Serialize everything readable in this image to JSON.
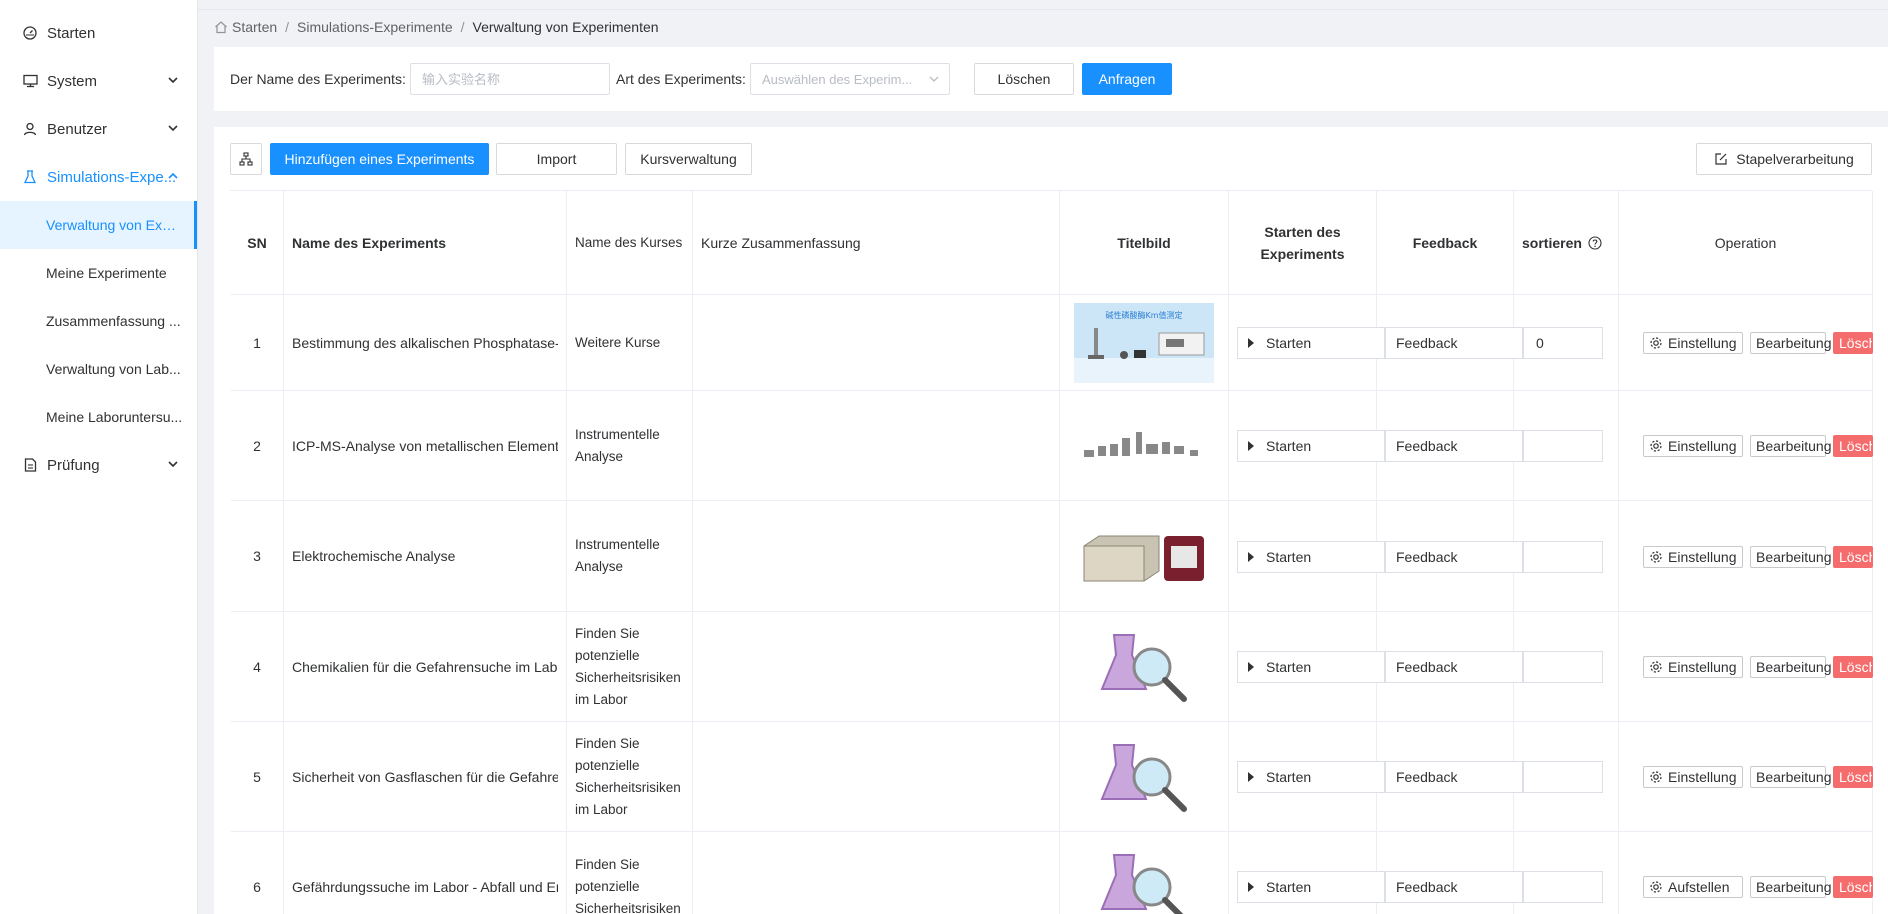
{
  "sidebar": {
    "items": [
      {
        "label": "Starten",
        "icon": "dashboard-icon"
      },
      {
        "label": "System",
        "icon": "monitor-icon"
      },
      {
        "label": "Benutzer",
        "icon": "user-icon"
      },
      {
        "label": "Simulations-Expe...",
        "icon": "flask-icon"
      },
      {
        "label": "Prüfung",
        "icon": "document-icon"
      }
    ],
    "subitems": [
      "Verwaltung von Exp...",
      "Meine Experimente",
      "Zusammenfassung ...",
      "Verwaltung von Lab...",
      "Meine Laboruntersu..."
    ]
  },
  "breadcrumb": {
    "home": "Starten",
    "sep": "/",
    "level2": "Simulations-Experimente",
    "current": "Verwaltung von Experimenten"
  },
  "search": {
    "name_label": "Der Name des Experiments:",
    "name_placeholder": "输入实验名称",
    "type_label": "Art des Experiments:",
    "type_placeholder": "Auswählen des Experim...",
    "reset_label": "Löschen",
    "query_label": "Anfragen"
  },
  "toolbar": {
    "add_label": "Hinzufügen eines Experiments",
    "import_label": "Import",
    "course_label": "Kursverwaltung",
    "batch_label": "Stapelverarbeitung"
  },
  "table": {
    "headers": {
      "sn": "SN",
      "name": "Name des Experiments",
      "course": "Name des Kurses",
      "summary": "Kurze Zusammenfassung",
      "cover": "Titelbild",
      "start": "Starten des Experiments",
      "feedback": "Feedback",
      "sort": "sortieren",
      "operation": "Operation"
    },
    "rows": [
      {
        "sn": "1",
        "name": "Bestimmung des alkalischen Phosphatase-K",
        "course": "Weitere Kurse",
        "start": "Starten",
        "feedback": "Feedback",
        "sort": "0",
        "setting": "Einstellung",
        "edit": "Bearbeitung",
        "delete": "Löschen",
        "cover_text": "碱性磷酸酶Km值测定"
      },
      {
        "sn": "2",
        "name": "ICP-MS-Analyse von metallischen Elemente",
        "course": "Instrumentelle Analyse",
        "start": "Starten",
        "feedback": "Feedback",
        "sort": "",
        "setting": "Einstellung",
        "edit": "Bearbeitung",
        "delete": "Löschen"
      },
      {
        "sn": "3",
        "name": "Elektrochemische Analyse",
        "course": "Instrumentelle Analyse",
        "start": "Starten",
        "feedback": "Feedback",
        "sort": "",
        "setting": "Einstellung",
        "edit": "Bearbeitung",
        "delete": "Löschen"
      },
      {
        "sn": "4",
        "name": "Chemikalien für die Gefahrensuche im Labo",
        "course": "Finden Sie potenzielle Sicherheitsrisiken im Labor",
        "start": "Starten",
        "feedback": "Feedback",
        "sort": "",
        "setting": "Einstellung",
        "edit": "Bearbeitung",
        "delete": "Löschen"
      },
      {
        "sn": "5",
        "name": "Sicherheit von Gasflaschen für die Gefahrer",
        "course": "Finden Sie potenzielle Sicherheitsrisiken im Labor",
        "start": "Starten",
        "feedback": "Feedback",
        "sort": "",
        "setting": "Einstellung",
        "edit": "Bearbeitung",
        "delete": "Löschen"
      },
      {
        "sn": "6",
        "name": "Gefährdungssuche im Labor - Abfall und Er",
        "course": "Finden Sie potenzielle Sicherheitsrisiken",
        "start": "Starten",
        "feedback": "Feedback",
        "sort": "",
        "setting": "Aufstellen",
        "edit": "Bearbeitung",
        "delete": "Löschen"
      }
    ]
  },
  "colors": {
    "primary": "#1890ff",
    "danger": "#f56c6c",
    "sidebar_active_bg": "#e6f4ff"
  }
}
